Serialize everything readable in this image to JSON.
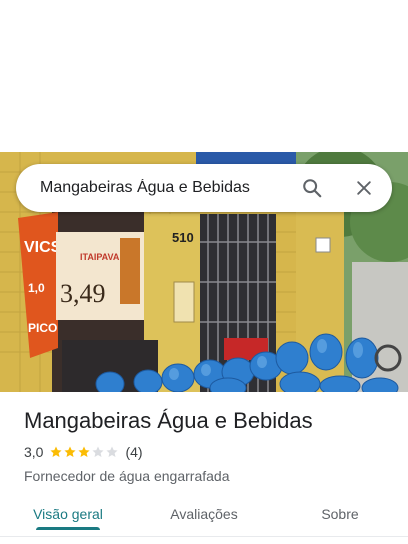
{
  "search": {
    "query": "Mangabeiras Água e Bebidas",
    "search_icon": "search-icon",
    "close_icon": "close-icon"
  },
  "photo": {
    "storefront_sign_number": "510",
    "banner_text": "ITAIPAVA"
  },
  "place": {
    "name": "Mangabeiras Água e Bebidas",
    "rating": "3,0",
    "rating_value": 3,
    "rating_max": 5,
    "review_count": "(4)",
    "category": "Fornecedor de água engarrafada"
  },
  "tabs": [
    {
      "label": "Visão geral",
      "active": true
    },
    {
      "label": "Avaliações",
      "active": false
    },
    {
      "label": "Sobre",
      "active": false
    }
  ],
  "colors": {
    "accent": "#1a7a82",
    "star_filled": "#fbbc04",
    "star_empty": "#dadce0"
  }
}
